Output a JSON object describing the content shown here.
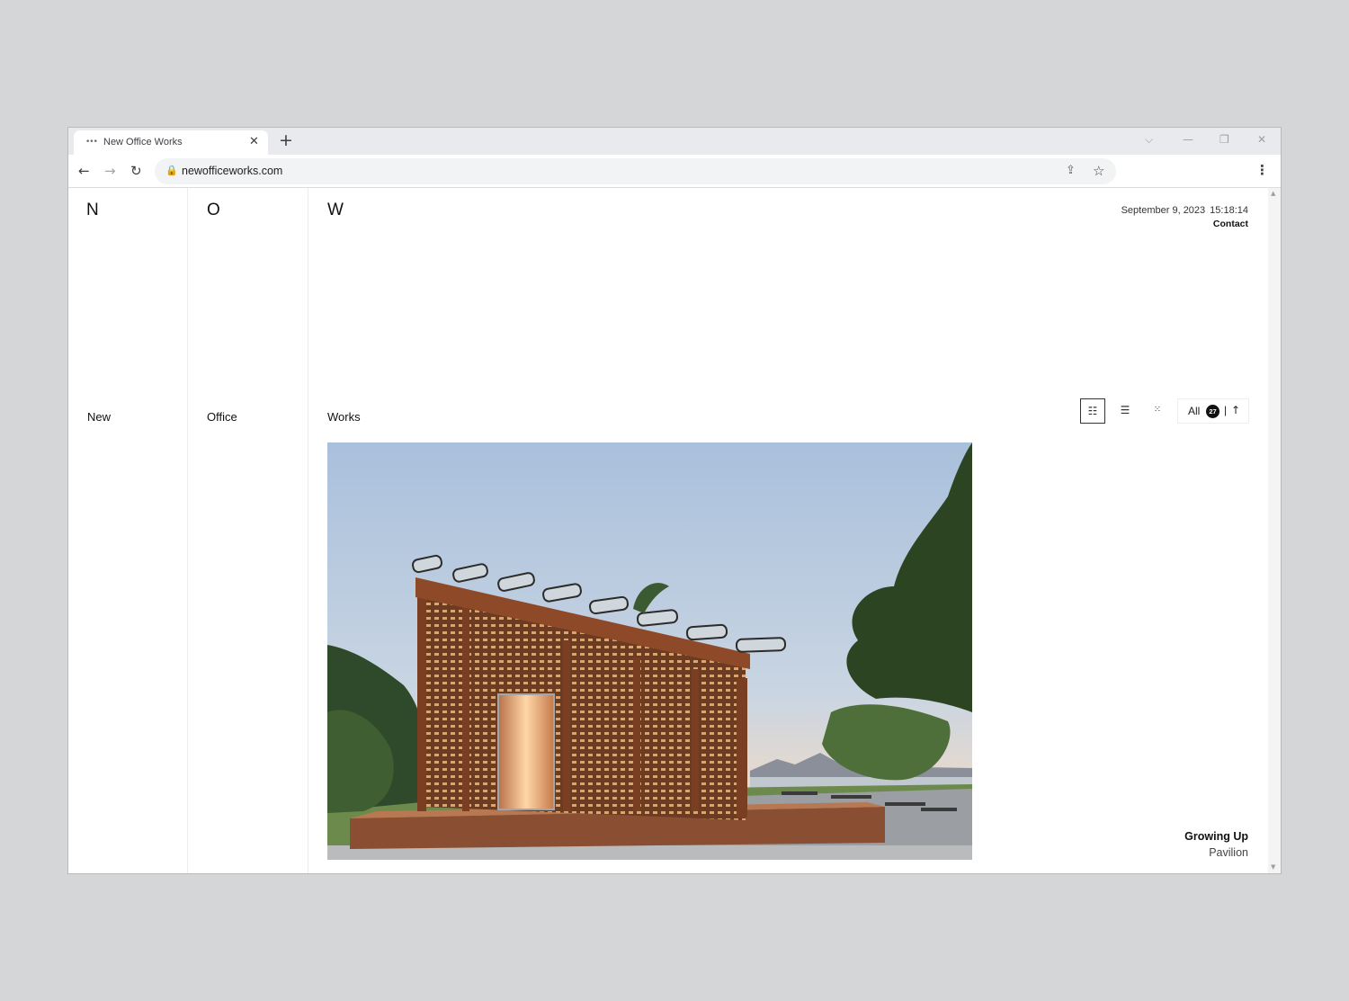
{
  "browser": {
    "tab_title": "New Office Works",
    "favicon": "•••",
    "tab_close_glyph": "✕",
    "new_tab_glyph": "+",
    "window_controls": {
      "chevron": "⌵",
      "minimize": "—",
      "maximize": "❐",
      "close": "✕"
    },
    "url": "newofficeworks.com",
    "icons": {
      "back": "←",
      "forward": "→",
      "reload": "↻",
      "lock": "🔒",
      "share": "⇪",
      "star": "☆",
      "menu": "⋮"
    }
  },
  "site": {
    "letters": [
      "N",
      "O",
      "W"
    ],
    "words": [
      "New",
      "Office",
      "Works"
    ],
    "date": "September 9, 2023",
    "time": "15:18:14",
    "contact": "Contact",
    "view_modes": {
      "detail": "☷",
      "list": "☰",
      "grid": "⁙"
    },
    "filter": {
      "label": "All",
      "count": "27",
      "separator": "|",
      "sort_arrow": "↑"
    },
    "project": {
      "title": "Growing Up",
      "subtitle": "Pavilion"
    }
  },
  "scrollbar": {
    "up": "▲",
    "down": "▼"
  },
  "colors": {
    "page_background": "#d5d6d8",
    "tab_strip": "#e8eaed",
    "omnibox": "#f1f3f4",
    "text": "#111111"
  }
}
